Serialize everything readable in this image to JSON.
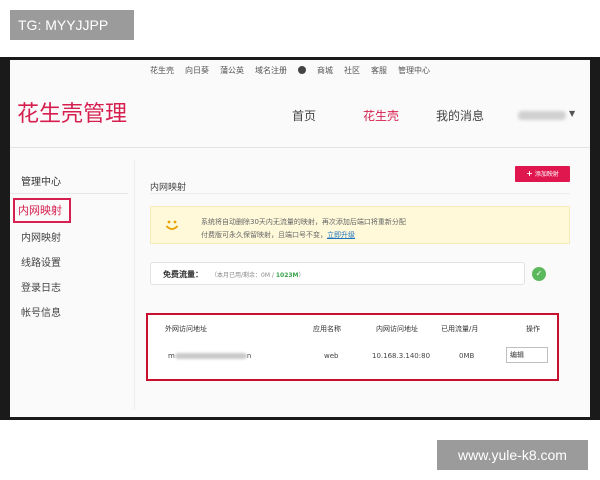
{
  "watermarks": {
    "top": "TG: MYYJJPP",
    "bottom": "www.yule-k8.com"
  },
  "top_nav": [
    "花生壳",
    "向日葵",
    "蒲公英",
    "域名注册",
    "商城",
    "社区",
    "客服",
    "管理中心"
  ],
  "brand": "花生壳管理",
  "main_nav": {
    "home": "首页",
    "active": "花生壳",
    "messages": "我的消息"
  },
  "sidebar": {
    "section_title": "管理中心",
    "highlighted": "内网映射",
    "items": [
      "内网映射",
      "线路设置",
      "登录日志",
      "帐号信息"
    ]
  },
  "content": {
    "title": "内网映射",
    "add_button": "添加映射",
    "notice_line1": "系统将自动删除30天内无流量的映射，再次添加后端口将重新分配",
    "notice_line2": "付费版可永久保留映射，且端口号不变，",
    "notice_link": "立即升级",
    "traffic_label": "免费流量：",
    "traffic_info_prefix": "（本月已用/剩余：0M / ",
    "traffic_info_value": "1023M",
    "traffic_info_suffix": "）"
  },
  "table": {
    "headers": {
      "external": "外网访问地址",
      "app": "应用名称",
      "internal": "内网访问地址",
      "traffic": "已用流量/月",
      "action": "操作"
    },
    "row": {
      "external_prefix": "m",
      "external_suffix": "n",
      "app": "web",
      "internal": "10.168.3.140:80",
      "traffic": "0MB",
      "action": "编辑"
    }
  },
  "colors": {
    "brand": "#d61f4f",
    "highlight_border": "#c8102e",
    "notice_bg": "#fff9da",
    "ok": "#5cb85c"
  }
}
